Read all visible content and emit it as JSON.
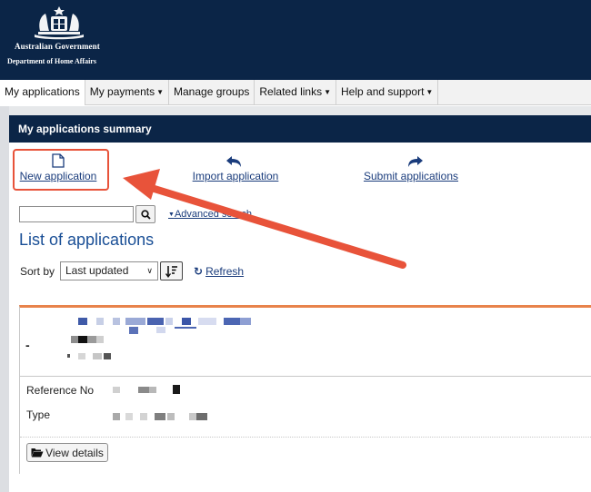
{
  "header": {
    "government_name": "Australian Government",
    "department_name": "Department of Home Affairs",
    "crest_icon": "coat-of-arms-icon",
    "background_color": "#0b2547"
  },
  "nav": {
    "items": [
      {
        "label": "My applications",
        "active": true
      },
      {
        "label": "My payments",
        "dropdown": true
      },
      {
        "label": "Manage groups"
      },
      {
        "label": "Related links",
        "dropdown": true
      },
      {
        "label": "Help and support",
        "dropdown": true
      }
    ]
  },
  "summary": {
    "title": "My applications summary"
  },
  "actions": {
    "new_application": {
      "label": "New application",
      "icon": "file-icon"
    },
    "import_application": {
      "label": "Import application",
      "icon": "import-icon"
    },
    "submit_applications": {
      "label": "Submit applications",
      "icon": "share-icon"
    }
  },
  "search": {
    "value": "",
    "button_icon": "search-icon",
    "advanced_label": "Advanced search"
  },
  "list": {
    "title": "List of applications",
    "sort_label": "Sort by",
    "sort_selected": "Last updated",
    "sort_direction_icon": "sort-descending-icon",
    "refresh_label": "Refresh",
    "refresh_icon": "refresh-icon"
  },
  "card": {
    "dash": "-",
    "fields": [
      {
        "label": "Reference No"
      },
      {
        "label": "Type"
      }
    ],
    "view_button_label": "View details",
    "view_button_icon": "folder-open-icon",
    "accent_color": "#e8834b"
  },
  "annotation": {
    "highlight_color": "#e8533a"
  }
}
